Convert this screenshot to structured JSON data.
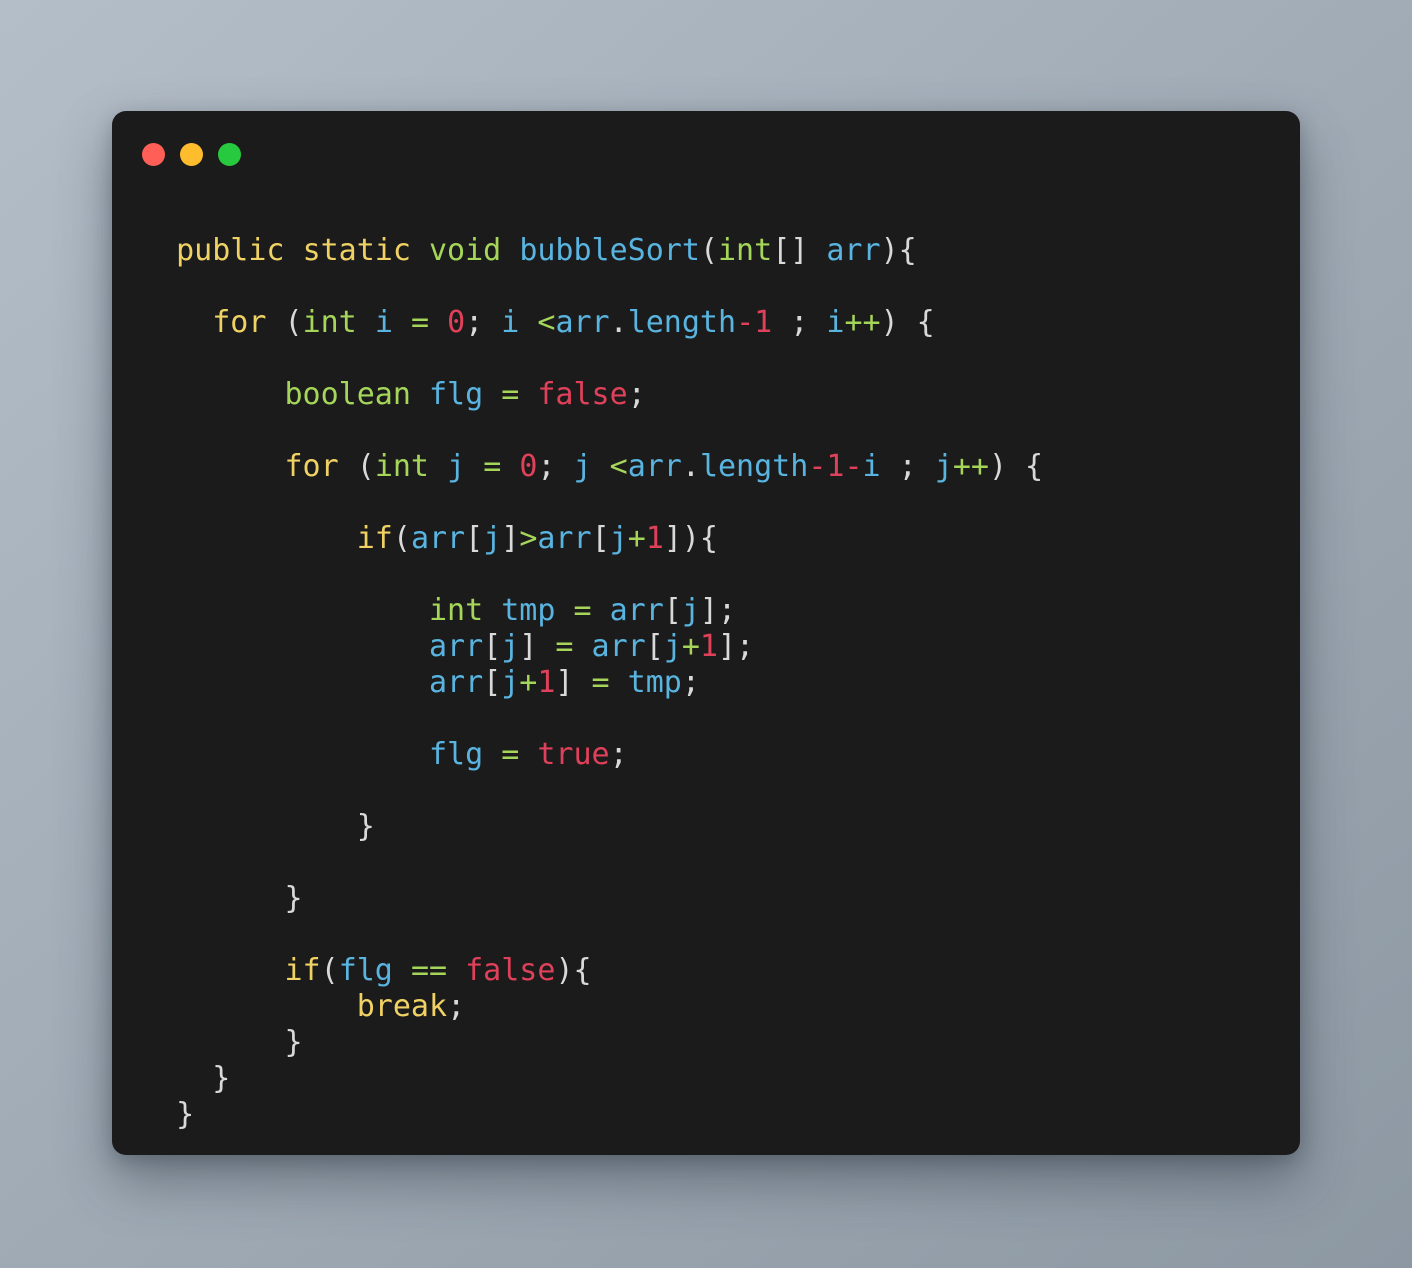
{
  "window": {
    "title": "",
    "traffic_lights": [
      {
        "name": "close",
        "color": "#ff5f56"
      },
      {
        "name": "minimize",
        "color": "#ffbd2e"
      },
      {
        "name": "maximize",
        "color": "#27c93f"
      }
    ]
  },
  "theme": {
    "card_background": "#1b1b1b",
    "page_background_from": "#b4bec8",
    "page_background_to": "#8d98a3",
    "keyword": "#f0d264",
    "type": "#a5d65a",
    "identifier": "#59b4e0",
    "literal": "#e0415a",
    "punctuation": "#d9d9d9"
  },
  "code": {
    "language": "java",
    "plain_text": "public static void bubbleSort(int[] arr){\n\n    for (int i = 0; i <arr.length-1 ; i++) {\n\n        boolean flg = false;\n\n        for (int j = 0; j <arr.length-1-i ; j++) {\n\n            if(arr[j]>arr[j+1]){\n\n                int tmp = arr[j];\n                arr[j] = arr[j+1];\n                arr[j+1] = tmp;\n\n                flg = true;\n\n            }\n\n        }\n\n        if(flg == false){\n            break;\n        }\n    }\n}",
    "lines": [
      {
        "id": "signature",
        "indent": "  ",
        "spacing": "gap-lg",
        "tokens": [
          {
            "text": "public",
            "kind": "kw"
          },
          {
            "text": " ",
            "kind": "pun"
          },
          {
            "text": "static",
            "kind": "kw"
          },
          {
            "text": " ",
            "kind": "pun"
          },
          {
            "text": "void",
            "kind": "type"
          },
          {
            "text": " ",
            "kind": "pun"
          },
          {
            "text": "bubbleSort",
            "kind": "var"
          },
          {
            "text": "(",
            "kind": "pun"
          },
          {
            "text": "int",
            "kind": "type"
          },
          {
            "text": "[] ",
            "kind": "pun"
          },
          {
            "text": "arr",
            "kind": "var"
          },
          {
            "text": "){",
            "kind": "pun"
          }
        ]
      },
      {
        "id": "outer-for",
        "indent": "    ",
        "spacing": "gap-lg",
        "tokens": [
          {
            "text": "for",
            "kind": "kw"
          },
          {
            "text": " (",
            "kind": "pun"
          },
          {
            "text": "int",
            "kind": "type"
          },
          {
            "text": " ",
            "kind": "pun"
          },
          {
            "text": "i",
            "kind": "var"
          },
          {
            "text": " ",
            "kind": "pun"
          },
          {
            "text": "=",
            "kind": "op"
          },
          {
            "text": " ",
            "kind": "pun"
          },
          {
            "text": "0",
            "kind": "num"
          },
          {
            "text": "; ",
            "kind": "pun"
          },
          {
            "text": "i",
            "kind": "var"
          },
          {
            "text": " ",
            "kind": "pun"
          },
          {
            "text": "<",
            "kind": "op"
          },
          {
            "text": "arr",
            "kind": "var"
          },
          {
            "text": ".",
            "kind": "pun"
          },
          {
            "text": "length",
            "kind": "var"
          },
          {
            "text": "-1",
            "kind": "num"
          },
          {
            "text": " ; ",
            "kind": "pun"
          },
          {
            "text": "i",
            "kind": "var"
          },
          {
            "text": "++",
            "kind": "op"
          },
          {
            "text": ") {",
            "kind": "pun"
          }
        ]
      },
      {
        "id": "flag-decl",
        "indent": "        ",
        "spacing": "gap-lg",
        "tokens": [
          {
            "text": "boolean",
            "kind": "type"
          },
          {
            "text": " ",
            "kind": "pun"
          },
          {
            "text": "flg",
            "kind": "var"
          },
          {
            "text": " ",
            "kind": "pun"
          },
          {
            "text": "=",
            "kind": "op"
          },
          {
            "text": " ",
            "kind": "pun"
          },
          {
            "text": "false",
            "kind": "lit"
          },
          {
            "text": ";",
            "kind": "pun"
          }
        ]
      },
      {
        "id": "inner-for",
        "indent": "        ",
        "spacing": "gap-lg",
        "tokens": [
          {
            "text": "for",
            "kind": "kw"
          },
          {
            "text": " (",
            "kind": "pun"
          },
          {
            "text": "int",
            "kind": "type"
          },
          {
            "text": " ",
            "kind": "pun"
          },
          {
            "text": "j",
            "kind": "var"
          },
          {
            "text": " ",
            "kind": "pun"
          },
          {
            "text": "=",
            "kind": "op"
          },
          {
            "text": " ",
            "kind": "pun"
          },
          {
            "text": "0",
            "kind": "num"
          },
          {
            "text": "; ",
            "kind": "pun"
          },
          {
            "text": "j",
            "kind": "var"
          },
          {
            "text": " ",
            "kind": "pun"
          },
          {
            "text": "<",
            "kind": "op"
          },
          {
            "text": "arr",
            "kind": "var"
          },
          {
            "text": ".",
            "kind": "pun"
          },
          {
            "text": "length",
            "kind": "var"
          },
          {
            "text": "-1",
            "kind": "num"
          },
          {
            "text": "-",
            "kind": "num"
          },
          {
            "text": "i",
            "kind": "var"
          },
          {
            "text": " ; ",
            "kind": "pun"
          },
          {
            "text": "j",
            "kind": "var"
          },
          {
            "text": "++",
            "kind": "op"
          },
          {
            "text": ") {",
            "kind": "pun"
          }
        ]
      },
      {
        "id": "compare-if",
        "indent": "            ",
        "spacing": "gap-lg",
        "tokens": [
          {
            "text": "if",
            "kind": "kw"
          },
          {
            "text": "(",
            "kind": "pun"
          },
          {
            "text": "arr",
            "kind": "var"
          },
          {
            "text": "[",
            "kind": "pun"
          },
          {
            "text": "j",
            "kind": "var"
          },
          {
            "text": "]",
            "kind": "pun"
          },
          {
            "text": ">",
            "kind": "op"
          },
          {
            "text": "arr",
            "kind": "var"
          },
          {
            "text": "[",
            "kind": "pun"
          },
          {
            "text": "j",
            "kind": "var"
          },
          {
            "text": "+",
            "kind": "op"
          },
          {
            "text": "1",
            "kind": "num"
          },
          {
            "text": "]){",
            "kind": "pun"
          }
        ]
      },
      {
        "id": "swap-tmp-assign",
        "indent": "                ",
        "spacing": "gap-lg",
        "tokens": [
          {
            "text": "int",
            "kind": "type"
          },
          {
            "text": " ",
            "kind": "pun"
          },
          {
            "text": "tmp",
            "kind": "var"
          },
          {
            "text": " ",
            "kind": "pun"
          },
          {
            "text": "=",
            "kind": "op"
          },
          {
            "text": " ",
            "kind": "pun"
          },
          {
            "text": "arr",
            "kind": "var"
          },
          {
            "text": "[",
            "kind": "pun"
          },
          {
            "text": "j",
            "kind": "var"
          },
          {
            "text": "];",
            "kind": "pun"
          }
        ]
      },
      {
        "id": "swap-first",
        "indent": "                ",
        "spacing": "gap-sm",
        "tokens": [
          {
            "text": "arr",
            "kind": "var"
          },
          {
            "text": "[",
            "kind": "pun"
          },
          {
            "text": "j",
            "kind": "var"
          },
          {
            "text": "]",
            "kind": "pun"
          },
          {
            "text": " ",
            "kind": "pun"
          },
          {
            "text": "=",
            "kind": "op"
          },
          {
            "text": " ",
            "kind": "pun"
          },
          {
            "text": "arr",
            "kind": "var"
          },
          {
            "text": "[",
            "kind": "pun"
          },
          {
            "text": "j",
            "kind": "var"
          },
          {
            "text": "+",
            "kind": "op"
          },
          {
            "text": "1",
            "kind": "num"
          },
          {
            "text": "];",
            "kind": "pun"
          }
        ]
      },
      {
        "id": "swap-second",
        "indent": "                ",
        "spacing": "gap-sm",
        "tokens": [
          {
            "text": "arr",
            "kind": "var"
          },
          {
            "text": "[",
            "kind": "pun"
          },
          {
            "text": "j",
            "kind": "var"
          },
          {
            "text": "+",
            "kind": "op"
          },
          {
            "text": "1",
            "kind": "num"
          },
          {
            "text": "]",
            "kind": "pun"
          },
          {
            "text": " ",
            "kind": "pun"
          },
          {
            "text": "=",
            "kind": "op"
          },
          {
            "text": " ",
            "kind": "pun"
          },
          {
            "text": "tmp",
            "kind": "var"
          },
          {
            "text": ";",
            "kind": "pun"
          }
        ]
      },
      {
        "id": "flag-set-true",
        "indent": "                ",
        "spacing": "gap-lg",
        "tokens": [
          {
            "text": "flg",
            "kind": "var"
          },
          {
            "text": " ",
            "kind": "pun"
          },
          {
            "text": "=",
            "kind": "op"
          },
          {
            "text": " ",
            "kind": "pun"
          },
          {
            "text": "true",
            "kind": "lit"
          },
          {
            "text": ";",
            "kind": "pun"
          }
        ]
      },
      {
        "id": "close-if-compare",
        "indent": "            ",
        "spacing": "gap-lg",
        "tokens": [
          {
            "text": "}",
            "kind": "pun"
          }
        ]
      },
      {
        "id": "close-inner-for",
        "indent": "        ",
        "spacing": "gap-lg",
        "tokens": [
          {
            "text": "}",
            "kind": "pun"
          }
        ]
      },
      {
        "id": "early-exit-if",
        "indent": "        ",
        "spacing": "gap-lg",
        "tokens": [
          {
            "text": "if",
            "kind": "kw"
          },
          {
            "text": "(",
            "kind": "pun"
          },
          {
            "text": "flg",
            "kind": "var"
          },
          {
            "text": " ",
            "kind": "pun"
          },
          {
            "text": "==",
            "kind": "op"
          },
          {
            "text": " ",
            "kind": "pun"
          },
          {
            "text": "false",
            "kind": "lit"
          },
          {
            "text": "){",
            "kind": "pun"
          }
        ]
      },
      {
        "id": "break-stmt",
        "indent": "            ",
        "spacing": "gap-sm",
        "tokens": [
          {
            "text": "break",
            "kind": "kw"
          },
          {
            "text": ";",
            "kind": "pun"
          }
        ]
      },
      {
        "id": "close-early-exit-if",
        "indent": "        ",
        "spacing": "gap-sm",
        "tokens": [
          {
            "text": "}",
            "kind": "pun"
          }
        ]
      },
      {
        "id": "close-outer-for",
        "indent": "    ",
        "spacing": "gap-sm",
        "tokens": [
          {
            "text": "}",
            "kind": "pun"
          }
        ]
      },
      {
        "id": "close-method",
        "indent": "  ",
        "spacing": "gap-sm",
        "tokens": [
          {
            "text": "}",
            "kind": "pun"
          }
        ]
      }
    ]
  }
}
